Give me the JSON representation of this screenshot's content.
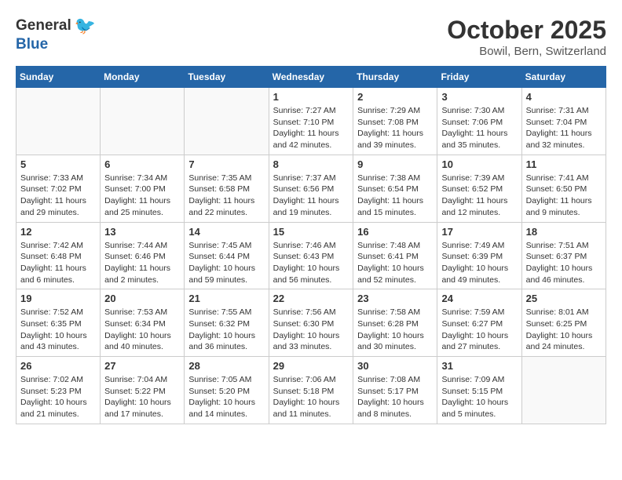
{
  "header": {
    "logo_general": "General",
    "logo_blue": "Blue",
    "month": "October 2025",
    "location": "Bowil, Bern, Switzerland"
  },
  "weekdays": [
    "Sunday",
    "Monday",
    "Tuesday",
    "Wednesday",
    "Thursday",
    "Friday",
    "Saturday"
  ],
  "weeks": [
    [
      {
        "day": "",
        "info": ""
      },
      {
        "day": "",
        "info": ""
      },
      {
        "day": "",
        "info": ""
      },
      {
        "day": "1",
        "info": "Sunrise: 7:27 AM\nSunset: 7:10 PM\nDaylight: 11 hours\nand 42 minutes."
      },
      {
        "day": "2",
        "info": "Sunrise: 7:29 AM\nSunset: 7:08 PM\nDaylight: 11 hours\nand 39 minutes."
      },
      {
        "day": "3",
        "info": "Sunrise: 7:30 AM\nSunset: 7:06 PM\nDaylight: 11 hours\nand 35 minutes."
      },
      {
        "day": "4",
        "info": "Sunrise: 7:31 AM\nSunset: 7:04 PM\nDaylight: 11 hours\nand 32 minutes."
      }
    ],
    [
      {
        "day": "5",
        "info": "Sunrise: 7:33 AM\nSunset: 7:02 PM\nDaylight: 11 hours\nand 29 minutes."
      },
      {
        "day": "6",
        "info": "Sunrise: 7:34 AM\nSunset: 7:00 PM\nDaylight: 11 hours\nand 25 minutes."
      },
      {
        "day": "7",
        "info": "Sunrise: 7:35 AM\nSunset: 6:58 PM\nDaylight: 11 hours\nand 22 minutes."
      },
      {
        "day": "8",
        "info": "Sunrise: 7:37 AM\nSunset: 6:56 PM\nDaylight: 11 hours\nand 19 minutes."
      },
      {
        "day": "9",
        "info": "Sunrise: 7:38 AM\nSunset: 6:54 PM\nDaylight: 11 hours\nand 15 minutes."
      },
      {
        "day": "10",
        "info": "Sunrise: 7:39 AM\nSunset: 6:52 PM\nDaylight: 11 hours\nand 12 minutes."
      },
      {
        "day": "11",
        "info": "Sunrise: 7:41 AM\nSunset: 6:50 PM\nDaylight: 11 hours\nand 9 minutes."
      }
    ],
    [
      {
        "day": "12",
        "info": "Sunrise: 7:42 AM\nSunset: 6:48 PM\nDaylight: 11 hours\nand 6 minutes."
      },
      {
        "day": "13",
        "info": "Sunrise: 7:44 AM\nSunset: 6:46 PM\nDaylight: 11 hours\nand 2 minutes."
      },
      {
        "day": "14",
        "info": "Sunrise: 7:45 AM\nSunset: 6:44 PM\nDaylight: 10 hours\nand 59 minutes."
      },
      {
        "day": "15",
        "info": "Sunrise: 7:46 AM\nSunset: 6:43 PM\nDaylight: 10 hours\nand 56 minutes."
      },
      {
        "day": "16",
        "info": "Sunrise: 7:48 AM\nSunset: 6:41 PM\nDaylight: 10 hours\nand 52 minutes."
      },
      {
        "day": "17",
        "info": "Sunrise: 7:49 AM\nSunset: 6:39 PM\nDaylight: 10 hours\nand 49 minutes."
      },
      {
        "day": "18",
        "info": "Sunrise: 7:51 AM\nSunset: 6:37 PM\nDaylight: 10 hours\nand 46 minutes."
      }
    ],
    [
      {
        "day": "19",
        "info": "Sunrise: 7:52 AM\nSunset: 6:35 PM\nDaylight: 10 hours\nand 43 minutes."
      },
      {
        "day": "20",
        "info": "Sunrise: 7:53 AM\nSunset: 6:34 PM\nDaylight: 10 hours\nand 40 minutes."
      },
      {
        "day": "21",
        "info": "Sunrise: 7:55 AM\nSunset: 6:32 PM\nDaylight: 10 hours\nand 36 minutes."
      },
      {
        "day": "22",
        "info": "Sunrise: 7:56 AM\nSunset: 6:30 PM\nDaylight: 10 hours\nand 33 minutes."
      },
      {
        "day": "23",
        "info": "Sunrise: 7:58 AM\nSunset: 6:28 PM\nDaylight: 10 hours\nand 30 minutes."
      },
      {
        "day": "24",
        "info": "Sunrise: 7:59 AM\nSunset: 6:27 PM\nDaylight: 10 hours\nand 27 minutes."
      },
      {
        "day": "25",
        "info": "Sunrise: 8:01 AM\nSunset: 6:25 PM\nDaylight: 10 hours\nand 24 minutes."
      }
    ],
    [
      {
        "day": "26",
        "info": "Sunrise: 7:02 AM\nSunset: 5:23 PM\nDaylight: 10 hours\nand 21 minutes."
      },
      {
        "day": "27",
        "info": "Sunrise: 7:04 AM\nSunset: 5:22 PM\nDaylight: 10 hours\nand 17 minutes."
      },
      {
        "day": "28",
        "info": "Sunrise: 7:05 AM\nSunset: 5:20 PM\nDaylight: 10 hours\nand 14 minutes."
      },
      {
        "day": "29",
        "info": "Sunrise: 7:06 AM\nSunset: 5:18 PM\nDaylight: 10 hours\nand 11 minutes."
      },
      {
        "day": "30",
        "info": "Sunrise: 7:08 AM\nSunset: 5:17 PM\nDaylight: 10 hours\nand 8 minutes."
      },
      {
        "day": "31",
        "info": "Sunrise: 7:09 AM\nSunset: 5:15 PM\nDaylight: 10 hours\nand 5 minutes."
      },
      {
        "day": "",
        "info": ""
      }
    ]
  ]
}
